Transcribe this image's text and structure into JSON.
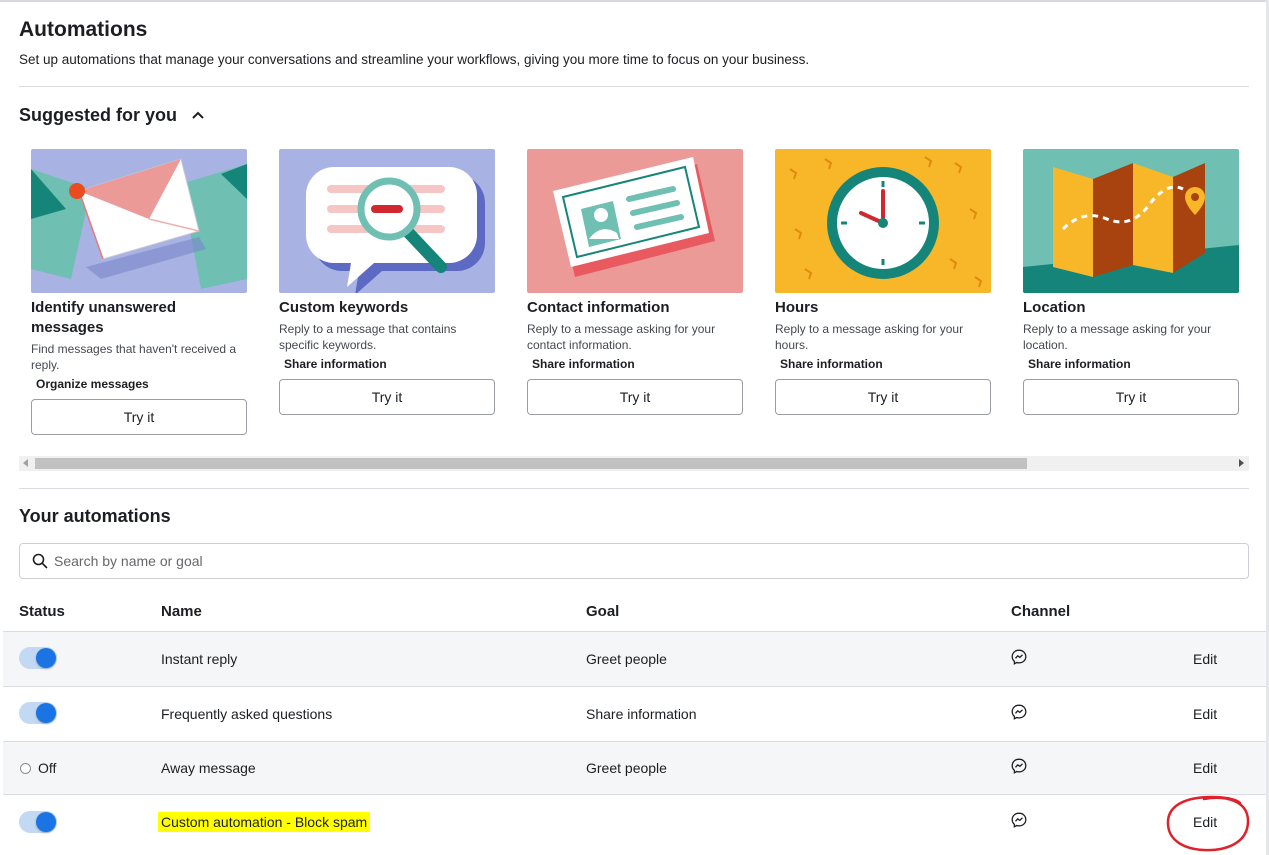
{
  "page": {
    "title": "Automations",
    "description": "Set up automations that manage your conversations and streamline your workflows, giving you more time to focus on your business."
  },
  "suggested": {
    "title": "Suggested for you",
    "cards": [
      {
        "title": "Identify unanswered messages",
        "description": "Find messages that haven't received a reply.",
        "tag": "Organize messages",
        "button": "Try it",
        "image_bg": "#a9b3e3"
      },
      {
        "title": "Custom keywords",
        "description": "Reply to a message that contains specific keywords.",
        "tag": "Share information",
        "button": "Try it",
        "image_bg": "#a9b3e3"
      },
      {
        "title": "Contact information",
        "description": "Reply to a message asking for your contact information.",
        "tag": "Share information",
        "button": "Try it",
        "image_bg": "#ec9a98"
      },
      {
        "title": "Hours",
        "description": "Reply to a message asking for your hours.",
        "tag": "Share information",
        "button": "Try it",
        "image_bg": "#f7b728"
      },
      {
        "title": "Location",
        "description": "Reply to a message asking for your location.",
        "tag": "Share information",
        "button": "Try it",
        "image_bg": "#6fbfb3"
      }
    ]
  },
  "automations": {
    "title": "Your automations",
    "search_placeholder": "Search by name or goal",
    "columns": {
      "status": "Status",
      "name": "Name",
      "goal": "Goal",
      "channel": "Channel"
    },
    "rows": [
      {
        "status": "on",
        "status_label": "",
        "name": "Instant reply",
        "goal": "Greet people",
        "channel_icon": "messenger-icon",
        "action": "Edit"
      },
      {
        "status": "on",
        "status_label": "",
        "name": "Frequently asked questions",
        "goal": "Share information",
        "channel_icon": "messenger-icon",
        "action": "Edit"
      },
      {
        "status": "off",
        "status_label": "Off",
        "name": "Away message",
        "goal": "Greet people",
        "channel_icon": "messenger-icon",
        "action": "Edit"
      },
      {
        "status": "on",
        "status_label": "",
        "name": "Custom automation - Block spam",
        "goal": "",
        "channel_icon": "messenger-icon",
        "action": "Edit"
      }
    ]
  },
  "colors": {
    "accent": "#1b74e4",
    "highlight": "#ffff00",
    "annotation": "#e0202a"
  }
}
